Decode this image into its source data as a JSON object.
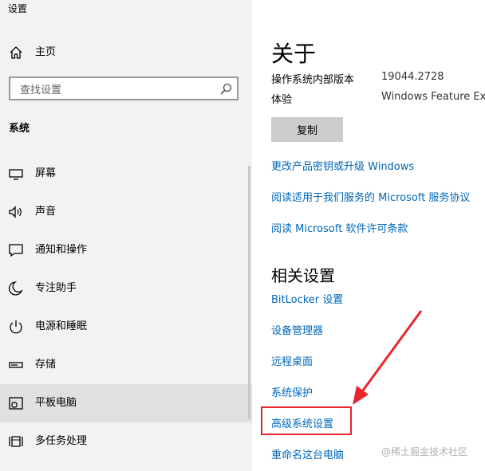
{
  "window": {
    "title": "设置"
  },
  "sidebar": {
    "home": {
      "label": "主页",
      "icon": "home-icon"
    },
    "search": {
      "placeholder": "查找设置",
      "icon": "search-icon"
    },
    "section_title": "系统",
    "items": [
      {
        "label": "屏幕",
        "icon": "display-icon",
        "selected": false
      },
      {
        "label": "声音",
        "icon": "speaker-icon",
        "selected": false
      },
      {
        "label": "通知和操作",
        "icon": "notification-icon",
        "selected": false
      },
      {
        "label": "专注助手",
        "icon": "moon-icon",
        "selected": false
      },
      {
        "label": "电源和睡眠",
        "icon": "power-icon",
        "selected": false
      },
      {
        "label": "存储",
        "icon": "storage-icon",
        "selected": false
      },
      {
        "label": "平板电脑",
        "icon": "tablet-icon",
        "selected": true
      },
      {
        "label": "多任务处理",
        "icon": "multitasking-icon",
        "selected": false
      }
    ]
  },
  "main": {
    "title": "关于",
    "specs": [
      {
        "label": "操作系统内部版本",
        "value": "19044.2728"
      },
      {
        "label": "体验",
        "value": "Windows Feature Exp"
      }
    ],
    "copy_button": "复制",
    "links": [
      "更改产品密钥或升级 Windows",
      "阅读适用于我们服务的 Microsoft 服务协议",
      "阅读 Microsoft 软件许可条款"
    ],
    "related_title": "相关设置",
    "related_links": [
      "BitLocker 设置",
      "设备管理器",
      "远程桌面",
      "系统保护",
      "高级系统设置",
      "重命名这台电脑"
    ],
    "highlighted_link": "高级系统设置"
  },
  "annotation": {
    "color": "#e8262c"
  },
  "watermark": "@稀土掘金技术社区",
  "colors": {
    "sidebar_bg": "#f2f2f2",
    "selected_bg": "#e0e0e0",
    "link": "#0067b8",
    "annotation": "#e8262c"
  }
}
